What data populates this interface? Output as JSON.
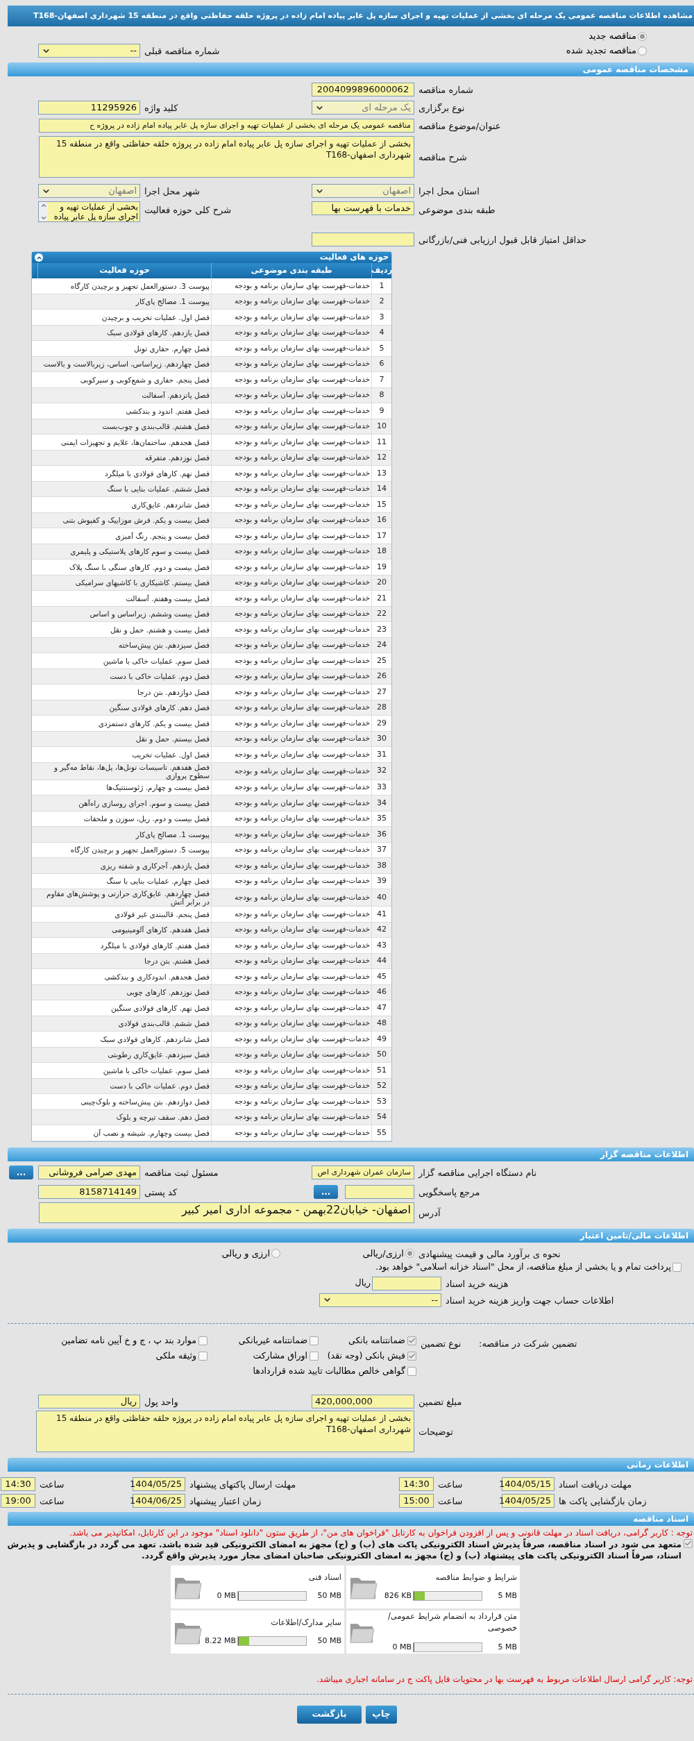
{
  "title": "مشاهده اطلاعات مناقصه عمومی یک مرحله ای بخشی از عملیات تهیه و اجرای سازه پل عابر پیاده امام زاده در پروژه حلقه حفاظتی واقع در منطقه 15 شهرداری اصفهان-T168",
  "tender_mode": [
    {
      "label": "مناقصه جدید",
      "selected": true
    },
    {
      "label": "مناقصه تجدید شده",
      "selected": false
    }
  ],
  "previous_number": {
    "label": "شماره مناقصه قبلی",
    "value": "--",
    "disabled": false
  },
  "general": {
    "section_title": "مشخصات مناقصه عمومی",
    "tender_number": {
      "label": "شماره مناقصه",
      "value": "2004099896000062"
    },
    "holding_type": {
      "label": "نوع برگزاری",
      "value": "یک مرحله ای",
      "disabled": true
    },
    "keyword": {
      "label": "کلید واژه",
      "value": "11295926"
    },
    "subject": {
      "label": "عنوان/موضوع مناقصه",
      "value": "مناقصه عمومی یک مرحله ای بخشی از عملیات تهیه و اجرای سازه پل عابر پیاده امام زاده در پروژه ح"
    },
    "description": {
      "label": "شرح مناقصه",
      "value": "بخشی از عملیات تهیه و اجرای سازه پل عابر پیاده امام زاده در پروژه حلقه حفاظتی واقع در منطقه 15 شهرداری اصفهان-T168"
    },
    "province": {
      "label": "استان محل اجرا",
      "value": "اصفهان",
      "disabled": true
    },
    "city": {
      "label": "شهر محل اجرا",
      "value": "اصفهان",
      "disabled": true
    },
    "category": {
      "label": "طبقه بندی موضوعی",
      "value": "خدمات با فهرست بها"
    },
    "activity_summary": {
      "label": "شرح کلی حوزه فعالیت",
      "value": "بخشی از عملیات تهیه و اجرای سازه پل عابر پیاده"
    },
    "min_score": {
      "label": "حداقل امتیاز قابل قبول ارزیابی فنی/بازرگانی"
    }
  },
  "activities": {
    "title": "حوزه های فعالیت",
    "expanded": true,
    "columns": [
      "ردیف",
      "طبقه بندی موضوعی",
      "حوزه فعالیت"
    ],
    "rows": [
      {
        "num": "1",
        "category": "خدمات-فهرست بهای سازمان برنامه و بودجه",
        "field": "پیوست 3. دستورالعمل تجهیز و برچیدن کارگاه"
      },
      {
        "num": "2",
        "category": "خدمات-فهرست بهای سازمان برنامه و بودجه",
        "field": "پیوست 1. مصالح پای‌کار"
      },
      {
        "num": "3",
        "category": "خدمات-فهرست بهای سازمان برنامه و بودجه",
        "field": "فصل اول. عملیات تخریب و برچیدن"
      },
      {
        "num": "4",
        "category": "خدمات-فهرست بهای سازمان برنامه و بودجه",
        "field": "فصل یازدهم. کارهای فولادی سبک"
      },
      {
        "num": "5",
        "category": "خدمات-فهرست بهای سازمان برنامه و بودجه",
        "field": "فصل چهارم. حفاری تونل"
      },
      {
        "num": "6",
        "category": "خدمات-فهرست بهای سازمان برنامه و بودجه",
        "field": "فصل چهاردهم. زیراساس، اساس، زیربالاست  و بالاست"
      },
      {
        "num": "7",
        "category": "خدمات-فهرست بهای سازمان برنامه و بودجه",
        "field": "فصل پنجم. حفاری و شمع‌کوبی و سپرکوبی"
      },
      {
        "num": "8",
        "category": "خدمات-فهرست بهای سازمان برنامه و بودجه",
        "field": "فصل پانزدهم. آسفالت"
      },
      {
        "num": "9",
        "category": "خدمات-فهرست بهای سازمان برنامه و بودجه",
        "field": "فصل هفتم. اندود و بندکشی"
      },
      {
        "num": "10",
        "category": "خدمات-فهرست بهای سازمان برنامه و بودجه",
        "field": "فصل هشتم. قالب‌بندی و چوب‌بست"
      },
      {
        "num": "11",
        "category": "خدمات-فهرست بهای سازمان برنامه و بودجه",
        "field": "فصل هجدهم. ساختمان‌ها، علایم و تجهیزات ایمنی"
      },
      {
        "num": "12",
        "category": "خدمات-فهرست بهای سازمان برنامه و بودجه",
        "field": "فصل نوزدهم. متفرقه"
      },
      {
        "num": "13",
        "category": "خدمات-فهرست بهای سازمان برنامه و بودجه",
        "field": "فصل نهم. کارهای فولادی با میلگرد"
      },
      {
        "num": "14",
        "category": "خدمات-فهرست بهای سازمان برنامه و بودجه",
        "field": "فصل ششم. عملیات بنایی با سنگ"
      },
      {
        "num": "15",
        "category": "خدمات-فهرست بهای سازمان برنامه و بودجه",
        "field": "فصل شانزدهم. عایق‌کاری"
      },
      {
        "num": "16",
        "category": "خدمات-فهرست بهای سازمان برنامه و بودجه",
        "field": "فصل بیست و یکم. فرش موزاییک و کفپوش بتنی"
      },
      {
        "num": "17",
        "category": "خدمات-فهرست بهای سازمان برنامه و بودجه",
        "field": "فصل بیست و پنجم. رنگ آمیزی"
      },
      {
        "num": "18",
        "category": "خدمات-فهرست بهای سازمان برنامه و بودجه",
        "field": "فصل بیست و سوم کارهای پلاستیکی و پلیمری"
      },
      {
        "num": "19",
        "category": "خدمات-فهرست بهای سازمان برنامه و بودجه",
        "field": "فصل بیست و دوم. کارهای سنگی با سنگ پلاک"
      },
      {
        "num": "20",
        "category": "خدمات-فهرست بهای سازمان برنامه و بودجه",
        "field": "فصل بیستم. کاشیکاری با کاشیهای سرامیکی"
      },
      {
        "num": "21",
        "category": "خدمات-فهرست بهای سازمان برنامه و بودجه",
        "field": "فصل بیست وهفتم. آسفالت"
      },
      {
        "num": "22",
        "category": "خدمات-فهرست بهای سازمان برنامه و بودجه",
        "field": "فصل بیست وششم. زیراساس و اساس"
      },
      {
        "num": "23",
        "category": "خدمات-فهرست بهای سازمان برنامه و بودجه",
        "field": "فصل بیست و هشتم. حمل و نقل"
      },
      {
        "num": "24",
        "category": "خدمات-فهرست بهای سازمان برنامه و بودجه",
        "field": "فصل سیزدهم. بتن پیش‌ساخته"
      },
      {
        "num": "25",
        "category": "خدمات-فهرست بهای سازمان برنامه و بودجه",
        "field": "فصل سوم. عملیات خاکی با ماشین"
      },
      {
        "num": "26",
        "category": "خدمات-فهرست بهای سازمان برنامه و بودجه",
        "field": "فصل دوم. عملیات خاکی با دست"
      },
      {
        "num": "27",
        "category": "خدمات-فهرست بهای سازمان برنامه و بودجه",
        "field": "فصل دوازدهم. بتن درجا"
      },
      {
        "num": "28",
        "category": "خدمات-فهرست بهای سازمان برنامه و بودجه",
        "field": "فصل دهم. کارهای فولادی سنگین"
      },
      {
        "num": "29",
        "category": "خدمات-فهرست بهای سازمان برنامه و بودجه",
        "field": "فصل بیست و یکم. کارهای دستمزدی"
      },
      {
        "num": "30",
        "category": "خدمات-فهرست بهای سازمان برنامه و بودجه",
        "field": "فصل بیستم. حمل و نقل"
      },
      {
        "num": "31",
        "category": "خدمات-فهرست بهای سازمان برنامه و بودجه",
        "field": "فصل اول. عملیات تخریب"
      },
      {
        "num": "32",
        "category": "خدمات-فهرست بهای سازمان برنامه و بودجه",
        "field": "فصل هفدهم. تاسیسات تونل‌ها، پل‌ها، نقاط مه‌گیر و سطوح پروازی"
      },
      {
        "num": "33",
        "category": "خدمات-فهرست بهای سازمان برنامه و بودجه",
        "field": "فصل بیست و چهارم. ژئوسنتتیک‌ها"
      },
      {
        "num": "34",
        "category": "خدمات-فهرست بهای سازمان برنامه و بودجه",
        "field": "فصل بیست و سوم. اجرای روسازی راه‌آهن"
      },
      {
        "num": "35",
        "category": "خدمات-فهرست بهای سازمان برنامه و بودجه",
        "field": "فصل بیست و دوم. ریل، سوزن و ملحقات"
      },
      {
        "num": "36",
        "category": "خدمات-فهرست بهای سازمان برنامه و بودجه",
        "field": "پیوست 1. مصالح پای‌کار"
      },
      {
        "num": "37",
        "category": "خدمات-فهرست بهای سازمان برنامه و بودجه",
        "field": "پیوست 5. دستورالعمل تجهیز و برچیدن کارگاه"
      },
      {
        "num": "38",
        "category": "خدمات-فهرست بهای سازمان برنامه و بودجه",
        "field": "فصل یازدهم. آجرکاری و شفته ریزی"
      },
      {
        "num": "39",
        "category": "خدمات-فهرست بهای سازمان برنامه و بودجه",
        "field": "فصل چهارم. عملیات بنایی با سنگ"
      },
      {
        "num": "40",
        "category": "خدمات-فهرست بهای سازمان برنامه و بودجه",
        "field": "فصل چهاردهم. عایق‌کاری حرارتی و پوشش‌های مقاوم در برابر آتش"
      },
      {
        "num": "41",
        "category": "خدمات-فهرست بهای سازمان برنامه و بودجه",
        "field": "فصل پنجم. قالببندی غیر فولادی"
      },
      {
        "num": "42",
        "category": "خدمات-فهرست بهای سازمان برنامه و بودجه",
        "field": "فصل هفدهم. کارهای آلومینیومی"
      },
      {
        "num": "43",
        "category": "خدمات-فهرست بهای سازمان برنامه و بودجه",
        "field": "فصل هفتم. کارهای فولادی با میلگرد"
      },
      {
        "num": "44",
        "category": "خدمات-فهرست بهای سازمان برنامه و بودجه",
        "field": "فصل هشتم. بتن درجا"
      },
      {
        "num": "45",
        "category": "خدمات-فهرست بهای سازمان برنامه و بودجه",
        "field": "فصل هجدهم. اندودکاری و بندکشی"
      },
      {
        "num": "46",
        "category": "خدمات-فهرست بهای سازمان برنامه و بودجه",
        "field": "فصل نوزدهم. کارهای چوبی"
      },
      {
        "num": "47",
        "category": "خدمات-فهرست بهای سازمان برنامه و بودجه",
        "field": "فصل نهم. کارهای فولادی سنگین"
      },
      {
        "num": "48",
        "category": "خدمات-فهرست بهای سازمان برنامه و بودجه",
        "field": "فصل ششم. قالب‌بندی فولادی"
      },
      {
        "num": "49",
        "category": "خدمات-فهرست بهای سازمان برنامه و بودجه",
        "field": "فصل شانزدهم. کارهای فولادی سبک"
      },
      {
        "num": "50",
        "category": "خدمات-فهرست بهای سازمان برنامه و بودجه",
        "field": "فصل سیزدهم. عایق‌کاری رطوبتی"
      },
      {
        "num": "51",
        "category": "خدمات-فهرست بهای سازمان برنامه و بودجه",
        "field": "فصل سوم. عملیات خاکی با ماشین"
      },
      {
        "num": "52",
        "category": "خدمات-فهرست بهای سازمان برنامه و بودجه",
        "field": "فصل دوم. عملیات خاکی با دست"
      },
      {
        "num": "53",
        "category": "خدمات-فهرست بهای سازمان برنامه و بودجه",
        "field": "فصل دوازدهم. بتن پیش‌ساخته و بلوک‌چینی"
      },
      {
        "num": "54",
        "category": "خدمات-فهرست بهای سازمان برنامه و بودجه",
        "field": "فصل دهم. سقف تیرچه و بلوک"
      },
      {
        "num": "55",
        "category": "خدمات-فهرست بهای سازمان برنامه و بودجه",
        "field": "فصل بیست وچهارم. شیشه و نصب آن"
      }
    ]
  },
  "organizer": {
    "section_title": "اطلاعات مناقصه گزار",
    "executor": {
      "label": "نام دستگاه اجرایی مناقصه گزار",
      "value": "سازمان عمران شهرداری اص"
    },
    "registrar": {
      "label": "مسئول ثبت مناقصه",
      "value": "مهدی صرامی فروشانی",
      "button": "..."
    },
    "respondent": {
      "label": "مرجع پاسخگویی",
      "button": "..."
    },
    "postal_code": {
      "label": "کد پستی",
      "value": "8158714149"
    },
    "address": {
      "label": "آدرس",
      "value": "اصفهان- خیابان22بهمن - مجموعه اداری امیر کبیر"
    }
  },
  "finance": {
    "section_title": "اطلاعات مالی/تامین اعتبار",
    "estimate": {
      "label": "نحوه ی برآورد مالی و قیمت پیشنهادی",
      "options": [
        {
          "label": "ارزی/ریالی",
          "selected": true
        },
        {
          "label": "ارزی و ریالی",
          "selected": false
        }
      ]
    },
    "treasury": {
      "label": "پرداخت تمام و یا بخشی از مبلغ مناقصه، از محل \"اسناد خزانه اسلامی\" خواهد بود.",
      "checked": false
    },
    "doc_fee": {
      "label": "هزینه خرید اسناد",
      "unit": "ریال"
    },
    "account": {
      "label": "اطلاعات حساب جهت واریز هزینه خرید اسناد",
      "value": "--"
    },
    "guarantee": {
      "label": "تضمین شرکت در مناقصه:",
      "type_label": "نوع تضمین",
      "options": [
        {
          "label": "ضمانتنامه بانکی",
          "checked": true
        },
        {
          "label": "ضمانتنامه غیربانکی",
          "checked": false
        },
        {
          "label": "موارد بند پ ، ج و خ آیین نامه تضامین",
          "checked": false
        },
        {
          "label": "فیش بانکی (وجه نقد)",
          "checked": true
        },
        {
          "label": "اوراق مشارکت",
          "checked": false
        },
        {
          "label": "وثیقه ملکی",
          "checked": false
        },
        {
          "label": "گواهی خالص مطالبات تایید شده قراردادها",
          "checked": false
        }
      ]
    },
    "amount": {
      "label": "مبلغ تضمین",
      "value": "420,000,000"
    },
    "currency": {
      "label": "واحد پول",
      "value": "ریال"
    },
    "notes": {
      "label": "توضیحات",
      "value": "بخشی از عملیات تهیه و اجرای سازه پل عابر پیاده امام زاده در پروژه حلقه حفاظتی واقع در منطقه 15 شهرداری اصفهان-T168"
    }
  },
  "schedule": {
    "section_title": "اطلاعات زمانی",
    "items": [
      {
        "label": "مهلت دریافت اسناد",
        "date": "1404/05/15",
        "time_label": "ساعت",
        "time": "14:30"
      },
      {
        "label": "مهلت ارسال پاکتهای پیشنهاد",
        "date": "1404/05/25",
        "time_label": "ساعت",
        "time": "14:30"
      },
      {
        "label": "زمان بازگشایی پاکت ها",
        "date": "1404/05/25",
        "time_label": "ساعت",
        "time": "15:00"
      },
      {
        "label": "زمان اعتبار پیشنهاد",
        "date": "1404/06/25",
        "time_label": "ساعت",
        "time": "19:00"
      }
    ]
  },
  "documents": {
    "section_title": "اسناد مناقصه",
    "notice": "توجه : کاربر گرامی، دریافت اسناد در مهلت قانونی و پس از افزودن فراخوان به کارتابل \"فراخوان های من\"، از طریق ستون \"دانلود اسناد\" موجود در این کارتابل، امکانپذیر می باشد.",
    "commitment": {
      "text": "متعهد می شود در اسناد مناقصه، صرفاً پذیرش اسناد الکترونیکی پاکت های (ب) و (ج) مجهز به امضای الکترونیکی قید شده باشد. تعهد می گردد در بازگشایی و پذیرش اسناد، صرفاً اسناد الکترونیکی پاکت های پیشنهاد (ب) و (ج) مجهز به امضای الکترونیکی صاحبان امضای مجاز مورد پذیرش واقع گردد.",
      "checked": true
    },
    "files": [
      {
        "title": "شرایط و ضوابط مناقصه",
        "used": "826 KB",
        "max": "5 MB",
        "level": 0.16
      },
      {
        "title": "اسناد فنی",
        "used": "0 MB",
        "max": "50 MB",
        "level": 0
      },
      {
        "title": "متن قرارداد به انضمام شرایط عمومی/خصوصی",
        "used": "0 MB",
        "max": "5 MB",
        "level": 0
      },
      {
        "title": "سایر مدارک/اطلاعات",
        "used": "8.22 MB",
        "max": "50 MB",
        "level": 0.16
      }
    ],
    "footer_note": "توجه: کاربر گرامی ارسال اطلاعات مربوط به فهرست بها در محتویات فایل پاکت ج در سامانه اجباری میباشد."
  },
  "buttons": [
    {
      "label": "چاپ"
    },
    {
      "label": "بازگشت"
    }
  ]
}
